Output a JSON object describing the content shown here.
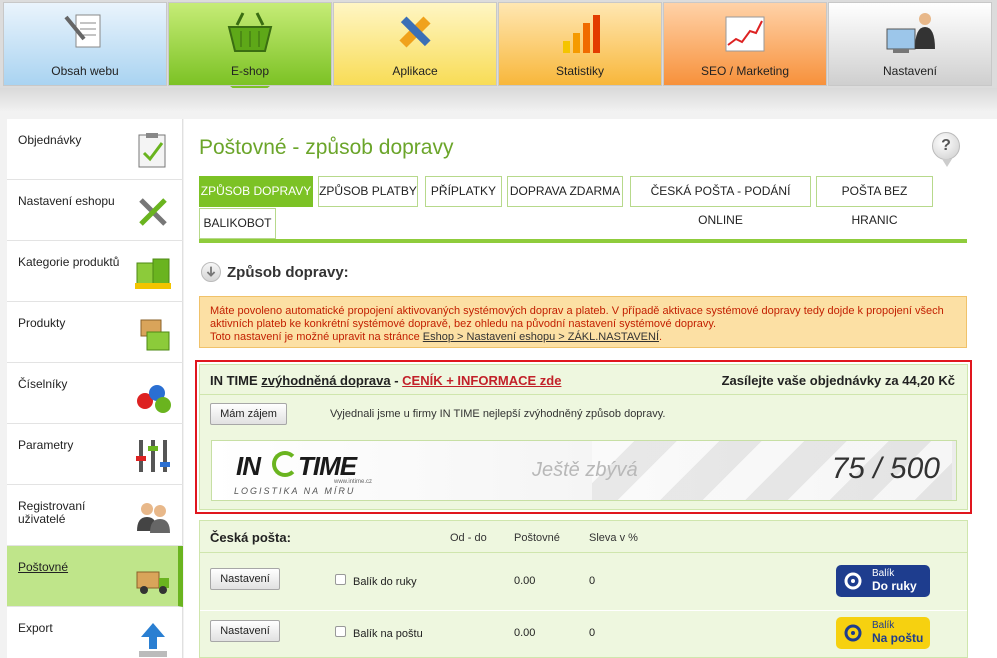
{
  "topnav": {
    "tabs": [
      {
        "label": "Obsah webu"
      },
      {
        "label": "E-shop"
      },
      {
        "label": "Aplikace"
      },
      {
        "label": "Statistiky"
      },
      {
        "label": "SEO / Marketing"
      },
      {
        "label": "Nastavení"
      }
    ],
    "active": "E-shop"
  },
  "sidebar": {
    "items": [
      {
        "label": "Objednávky",
        "icon": "clipboard-icon"
      },
      {
        "label": "Nastavení eshopu",
        "icon": "tools-icon"
      },
      {
        "label": "Kategorie produktů",
        "icon": "boxes-icon"
      },
      {
        "label": "Produkty",
        "icon": "package-icon"
      },
      {
        "label": "Číselníky",
        "icon": "numbers-icon"
      },
      {
        "label": "Parametry",
        "icon": "sliders-icon"
      },
      {
        "label": "Registrovaní uživatelé",
        "icon": "users-icon"
      },
      {
        "label": "Poštovné",
        "icon": "truck-icon"
      },
      {
        "label": "Export",
        "icon": "export-icon"
      }
    ],
    "active": "Poštovné"
  },
  "page": {
    "title": "Poštovné - způsob dopravy",
    "help": "?"
  },
  "subtabs": [
    {
      "label": "ZPŮSOB DOPRAVY"
    },
    {
      "label": "ZPŮSOB PLATBY"
    },
    {
      "label": "PŘÍPLATKY"
    },
    {
      "label": "DOPRAVA ZDARMA"
    },
    {
      "label": "ČESKÁ POŠTA - PODÁNÍ ONLINE"
    },
    {
      "label": "POŠTA BEZ HRANIC"
    },
    {
      "label": "BALIKOBOT"
    }
  ],
  "section": {
    "title": "Způsob dopravy:"
  },
  "notice": {
    "text1": "Máte povoleno automatické propojení aktivovaných systémových doprav a plateb. V případě aktivace systémové dopravy tedy dojde k propojení všech aktivních plateb ke konkrétní systémové dopravě, bez ohledu na původní nastavení systémové dopravy.",
    "text2": "Toto nastavení je možné upravit na stránce",
    "link": "Eshop > Nastavení eshopu > ZÁKL.NASTAVENÍ",
    "text3": "."
  },
  "intime": {
    "brand": "IN TIME",
    "link": "zvýhodněná doprava",
    "dash": " - ",
    "cenik": "CENÍK + INFORMACE zde",
    "right": "Zasílejte vaše objednávky za 44,20 Kč",
    "button": "Mám zájem",
    "desc": "Vyjednali jsme u firmy IN TIME nejlepší zvýhodněný způsob dopravy.",
    "banner": {
      "logo_in": "IN",
      "logo_time": "TIME",
      "web": "www.intime.cz",
      "tagline": "LOGISTIKA NA MÍRU",
      "remaining_label": "Ještě zbývá",
      "count": "75 / 500"
    }
  },
  "ceska_posta": {
    "title": "Česká pošta:",
    "columns": [
      "Od - do",
      "Poštovné",
      "Sleva v %"
    ],
    "rows": [
      {
        "button": "Nastavení",
        "name": "Balík do ruky",
        "postovne": "0.00",
        "sleva": "0",
        "badge_line1": "Balík",
        "badge_line2": "Do ruky",
        "badge_color": "#1e3d8e"
      },
      {
        "button": "Nastavení",
        "name": "Balík na poštu",
        "postovne": "0.00",
        "sleva": "0",
        "badge_line1": "Balík",
        "badge_line2": "Na poštu",
        "badge_color": "#f6d110"
      }
    ]
  }
}
